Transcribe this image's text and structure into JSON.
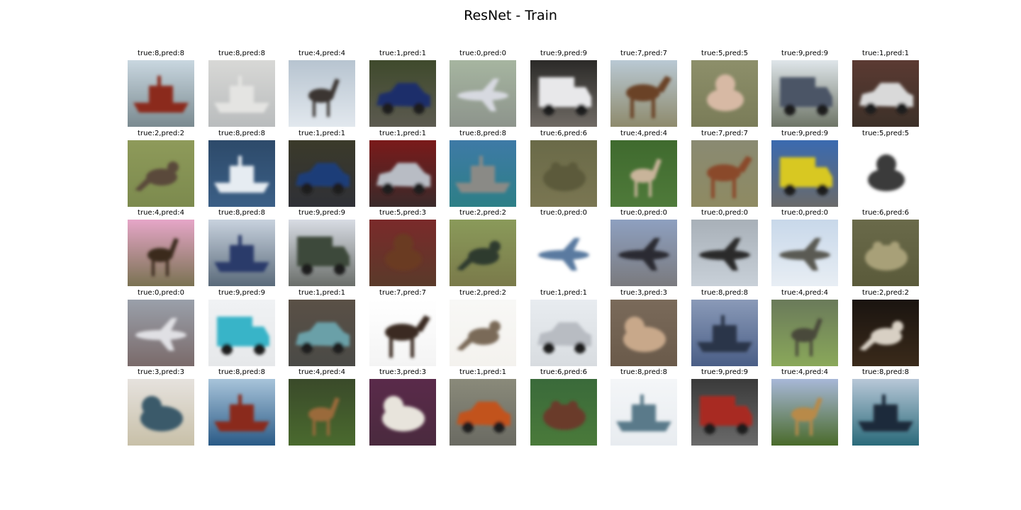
{
  "title": "ResNet - Train",
  "grid": {
    "rows": 5,
    "cols": 10
  },
  "samples": [
    {
      "label": "true:8,pred:8",
      "depicts": "ship-icon",
      "sky": "#c9d7e0",
      "ground": "#7a8a90",
      "subject": "#8b2a1d"
    },
    {
      "label": "true:8,pred:8",
      "depicts": "ship-icon",
      "sky": "#d8d8d6",
      "ground": "#b9bcbd",
      "subject": "#e4e4e2"
    },
    {
      "label": "true:4,pred:4",
      "depicts": "deer-icon",
      "sky": "#b7c4d0",
      "ground": "#e2e8ee",
      "subject": "#3a3630"
    },
    {
      "label": "true:1,pred:1",
      "depicts": "car-icon",
      "sky": "#3f4a2c",
      "ground": "#5c5a50",
      "subject": "#1f2f6a"
    },
    {
      "label": "true:0,pred:0",
      "depicts": "airplane-icon",
      "sky": "#a6b5a0",
      "ground": "#8d948c",
      "subject": "#d7d9e0"
    },
    {
      "label": "true:9,pred:9",
      "depicts": "truck-icon",
      "sky": "#2b2a28",
      "ground": "#6f6a64",
      "subject": "#e8e8ea"
    },
    {
      "label": "true:7,pred:7",
      "depicts": "horse-icon",
      "sky": "#b9c9d4",
      "ground": "#8e8a6c",
      "subject": "#6a4328"
    },
    {
      "label": "true:5,pred:5",
      "depicts": "dog-icon",
      "sky": "#8d8f6a",
      "ground": "#7a7c58",
      "subject": "#d7b9a4"
    },
    {
      "label": "true:9,pred:9",
      "depicts": "truck-icon",
      "sky": "#dfe6ea",
      "ground": "#6d7466",
      "subject": "#4b5566"
    },
    {
      "label": "true:1,pred:1",
      "depicts": "car-icon",
      "sky": "#5b3a32",
      "ground": "#3c3028",
      "subject": "#d9d9d9"
    },
    {
      "label": "true:2,pred:2",
      "depicts": "bird-icon",
      "sky": "#8e9a5a",
      "ground": "#7c8a4e",
      "subject": "#5a4a3a"
    },
    {
      "label": "true:8,pred:8",
      "depicts": "ship-icon",
      "sky": "#2d4a6a",
      "ground": "#3b5f86",
      "subject": "#e6ecf2"
    },
    {
      "label": "true:1,pred:1",
      "depicts": "car-icon",
      "sky": "#3b3a2a",
      "ground": "#2f3036",
      "subject": "#1e3c78"
    },
    {
      "label": "true:1,pred:1",
      "depicts": "car-icon",
      "sky": "#7a1a1a",
      "ground": "#3a2a2a",
      "subject": "#b8bcc4"
    },
    {
      "label": "true:8,pred:8",
      "depicts": "ship-icon",
      "sky": "#3e7aa6",
      "ground": "#2d7f86",
      "subject": "#8a8a86"
    },
    {
      "label": "true:6,pred:6",
      "depicts": "frog-icon",
      "sky": "#6a6a48",
      "ground": "#7a7652",
      "subject": "#5c5a3a"
    },
    {
      "label": "true:4,pred:4",
      "depicts": "deer-icon",
      "sky": "#3f6a2e",
      "ground": "#4f7a3a",
      "subject": "#c8b49a"
    },
    {
      "label": "true:7,pred:7",
      "depicts": "horse-icon",
      "sky": "#8a8a72",
      "ground": "#8e8a62",
      "subject": "#8a4a2a"
    },
    {
      "label": "true:9,pred:9",
      "depicts": "truck-icon",
      "sky": "#3a6ab0",
      "ground": "#6a6a6a",
      "subject": "#d8c820"
    },
    {
      "label": "true:5,pred:5",
      "depicts": "dog-icon",
      "sky": "#ffffff",
      "ground": "#ffffff",
      "subject": "#3a3a3a"
    },
    {
      "label": "true:4,pred:4",
      "depicts": "deer-icon",
      "sky": "#e6a6c8",
      "ground": "#7a7252",
      "subject": "#3a2a1e"
    },
    {
      "label": "true:8,pred:8",
      "depicts": "ship-icon",
      "sky": "#c8d2de",
      "ground": "#5a6a7a",
      "subject": "#2a3a6a"
    },
    {
      "label": "true:9,pred:9",
      "depicts": "truck-icon",
      "sky": "#d8dce4",
      "ground": "#6a6e6a",
      "subject": "#3e4a3a"
    },
    {
      "label": "true:5,pred:3",
      "depicts": "dog-icon",
      "sky": "#7a2a2a",
      "ground": "#5a3a2a",
      "subject": "#6a3a22"
    },
    {
      "label": "true:2,pred:2",
      "depicts": "bird-icon",
      "sky": "#8a9a5a",
      "ground": "#7a7a4a",
      "subject": "#2e3a2e"
    },
    {
      "label": "true:0,pred:0",
      "depicts": "airplane-icon",
      "sky": "#ffffff",
      "ground": "#ffffff",
      "subject": "#5a7aa0"
    },
    {
      "label": "true:0,pred:0",
      "depicts": "airplane-icon",
      "sky": "#8ea0c0",
      "ground": "#7a7a7e",
      "subject": "#2a2a30"
    },
    {
      "label": "true:0,pred:0",
      "depicts": "airplane-icon",
      "sky": "#a8b0b8",
      "ground": "#c8d0d8",
      "subject": "#2a2a2a"
    },
    {
      "label": "true:0,pred:0",
      "depicts": "airplane-icon",
      "sky": "#c8d8ea",
      "ground": "#e8eef4",
      "subject": "#5a5a52"
    },
    {
      "label": "true:6,pred:6",
      "depicts": "frog-icon",
      "sky": "#6a6a4a",
      "ground": "#5a5a3a",
      "subject": "#a8a078"
    },
    {
      "label": "true:0,pred:0",
      "depicts": "airplane-icon",
      "sky": "#9aa0aa",
      "ground": "#7a6a6a",
      "subject": "#e0e0e4"
    },
    {
      "label": "true:9,pred:9",
      "depicts": "truck-icon",
      "sky": "#f0f2f4",
      "ground": "#e6e8ea",
      "subject": "#38b4c8"
    },
    {
      "label": "true:1,pred:1",
      "depicts": "car-icon",
      "sky": "#5a5046",
      "ground": "#4a4a46",
      "subject": "#6aa0a8"
    },
    {
      "label": "true:7,pred:7",
      "depicts": "horse-icon",
      "sky": "#ffffff",
      "ground": "#f4f4f4",
      "subject": "#3a2a20"
    },
    {
      "label": "true:2,pred:2",
      "depicts": "bird-icon",
      "sky": "#f8f8f6",
      "ground": "#f4f2ee",
      "subject": "#7a6a58"
    },
    {
      "label": "true:1,pred:1",
      "depicts": "car-icon",
      "sky": "#e8ecf0",
      "ground": "#d8dce0",
      "subject": "#b8bcc2"
    },
    {
      "label": "true:3,pred:3",
      "depicts": "cat-icon",
      "sky": "#7a6a5a",
      "ground": "#6a5a4a",
      "subject": "#c8a88a"
    },
    {
      "label": "true:8,pred:8",
      "depicts": "ship-icon",
      "sky": "#8a9ab8",
      "ground": "#4a5e86",
      "subject": "#2a3448"
    },
    {
      "label": "true:4,pred:4",
      "depicts": "deer-icon",
      "sky": "#6a7a5a",
      "ground": "#8aa85a",
      "subject": "#4a4a3a"
    },
    {
      "label": "true:2,pred:2",
      "depicts": "bird-icon",
      "sky": "#1a1410",
      "ground": "#3a2a1a",
      "subject": "#d8d0c4"
    },
    {
      "label": "true:3,pred:3",
      "depicts": "cat-icon",
      "sky": "#e6e2de",
      "ground": "#c8c0a8",
      "subject": "#3a5a6a"
    },
    {
      "label": "true:8,pred:8",
      "depicts": "ship-icon",
      "sky": "#a8c4da",
      "ground": "#2a5a86",
      "subject": "#8a2a1e"
    },
    {
      "label": "true:4,pred:4",
      "depicts": "deer-icon",
      "sky": "#3a4a2a",
      "ground": "#4a6a2e",
      "subject": "#9a6a3a"
    },
    {
      "label": "true:3,pred:3",
      "depicts": "cat-icon",
      "sky": "#5a2a4a",
      "ground": "#4a2a3e",
      "subject": "#e8e4dc"
    },
    {
      "label": "true:1,pred:1",
      "depicts": "car-icon",
      "sky": "#8a8a7a",
      "ground": "#6a6a62",
      "subject": "#c2521e"
    },
    {
      "label": "true:6,pred:6",
      "depicts": "frog-icon",
      "sky": "#3a6a3a",
      "ground": "#4a7a3a",
      "subject": "#6a3a2a"
    },
    {
      "label": "true:8,pred:8",
      "depicts": "ship-icon",
      "sky": "#f4f6f8",
      "ground": "#e8ecf0",
      "subject": "#5a7a8a"
    },
    {
      "label": "true:9,pred:9",
      "depicts": "truck-icon",
      "sky": "#3a3a3a",
      "ground": "#6a6a6a",
      "subject": "#a82a22"
    },
    {
      "label": "true:4,pred:4",
      "depicts": "deer-icon",
      "sky": "#a8b8d8",
      "ground": "#4a6a2a",
      "subject": "#b88a4a"
    },
    {
      "label": "true:8,pred:8",
      "depicts": "ship-icon",
      "sky": "#b8c8d8",
      "ground": "#2a6a7a",
      "subject": "#1a2a3a"
    }
  ]
}
